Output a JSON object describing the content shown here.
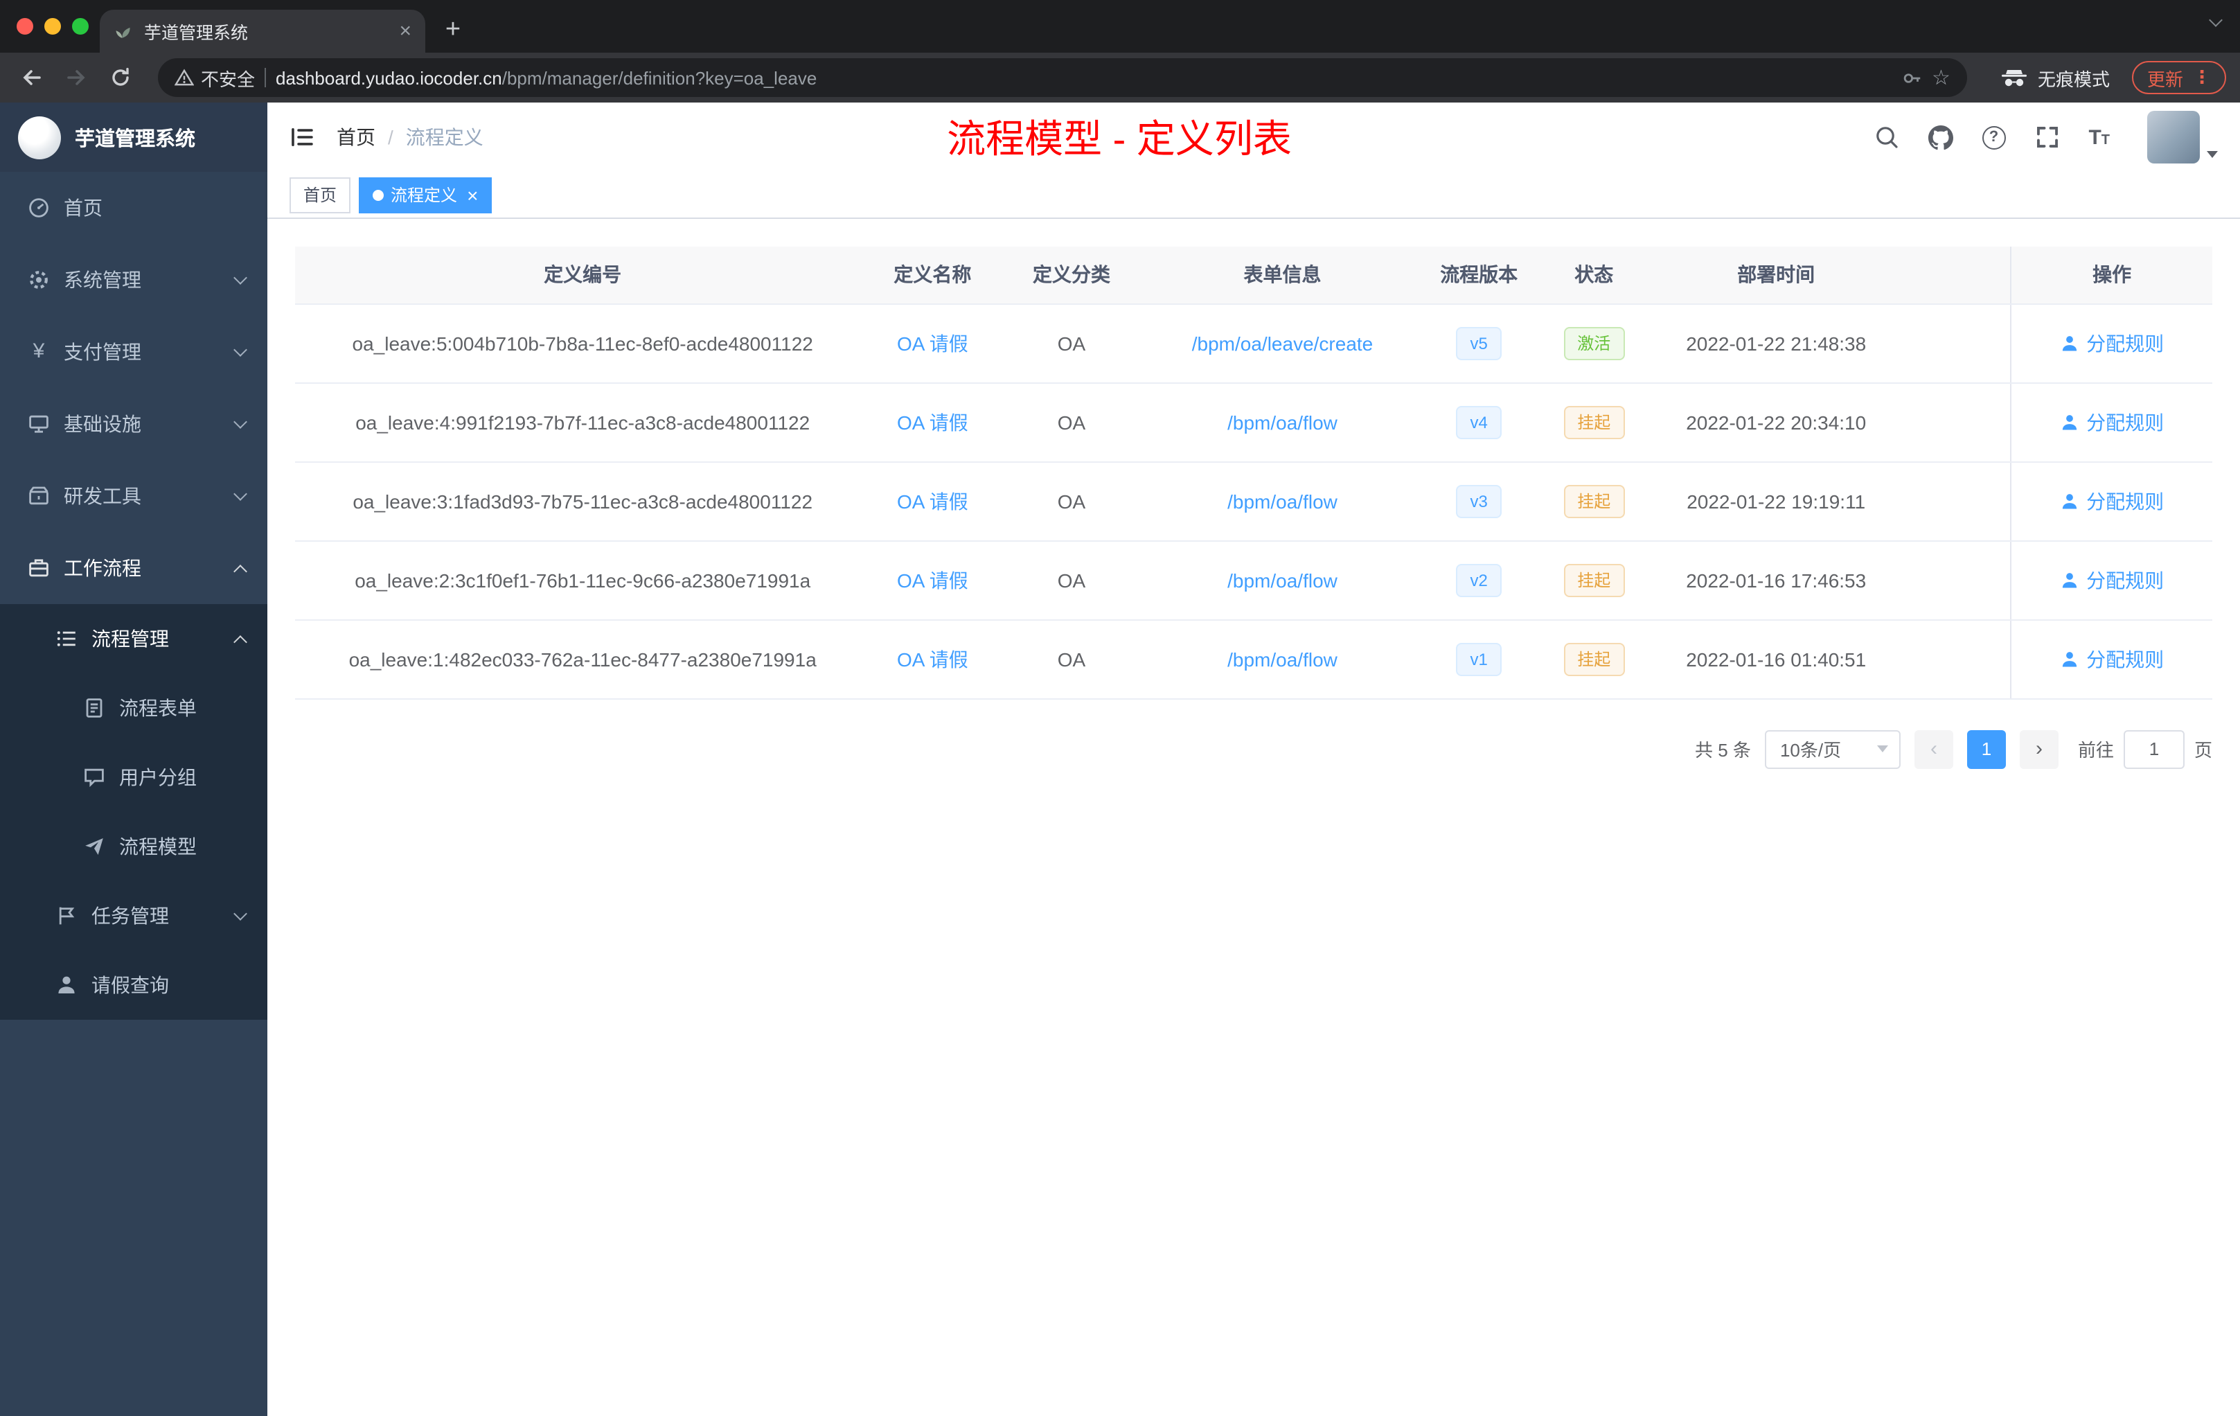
{
  "browser": {
    "tab_title": "芋道管理系统",
    "security_label": "不安全",
    "url_domain": "dashboard.yudao.iocoder.cn",
    "url_path": "/bpm/manager/definition?key=oa_leave",
    "incognito_label": "无痕模式",
    "update_label": "更新"
  },
  "sidebar": {
    "app_title": "芋道管理系统",
    "items": [
      {
        "label": "首页"
      },
      {
        "label": "系统管理"
      },
      {
        "label": "支付管理"
      },
      {
        "label": "基础设施"
      },
      {
        "label": "研发工具"
      },
      {
        "label": "工作流程"
      },
      {
        "label": "流程管理"
      },
      {
        "label": "流程表单"
      },
      {
        "label": "用户分组"
      },
      {
        "label": "流程模型"
      },
      {
        "label": "任务管理"
      },
      {
        "label": "请假查询"
      }
    ]
  },
  "header": {
    "breadcrumb": [
      "首页",
      "流程定义"
    ],
    "banner": "流程模型 - 定义列表"
  },
  "tags": [
    {
      "label": "首页"
    },
    {
      "label": "流程定义"
    }
  ],
  "table": {
    "columns": [
      "定义编号",
      "定义名称",
      "定义分类",
      "表单信息",
      "流程版本",
      "状态",
      "部署时间",
      "操作"
    ],
    "rows": [
      {
        "id": "oa_leave:5:004b710b-7b8a-11ec-8ef0-acde48001122",
        "name": "OA 请假",
        "category": "OA",
        "form": "/bpm/oa/leave/create",
        "version": "v5",
        "status": "激活",
        "status_type": "success",
        "deploy_time": "2022-01-22 21:48:38",
        "action": "分配规则"
      },
      {
        "id": "oa_leave:4:991f2193-7b7f-11ec-a3c8-acde48001122",
        "name": "OA 请假",
        "category": "OA",
        "form": "/bpm/oa/flow",
        "version": "v4",
        "status": "挂起",
        "status_type": "warning",
        "deploy_time": "2022-01-22 20:34:10",
        "action": "分配规则"
      },
      {
        "id": "oa_leave:3:1fad3d93-7b75-11ec-a3c8-acde48001122",
        "name": "OA 请假",
        "category": "OA",
        "form": "/bpm/oa/flow",
        "version": "v3",
        "status": "挂起",
        "status_type": "warning",
        "deploy_time": "2022-01-22 19:19:11",
        "action": "分配规则"
      },
      {
        "id": "oa_leave:2:3c1f0ef1-76b1-11ec-9c66-a2380e71991a",
        "name": "OA 请假",
        "category": "OA",
        "form": "/bpm/oa/flow",
        "version": "v2",
        "status": "挂起",
        "status_type": "warning",
        "deploy_time": "2022-01-16 17:46:53",
        "action": "分配规则"
      },
      {
        "id": "oa_leave:1:482ec033-762a-11ec-8477-a2380e71991a",
        "name": "OA 请假",
        "category": "OA",
        "form": "/bpm/oa/flow",
        "version": "v1",
        "status": "挂起",
        "status_type": "warning",
        "deploy_time": "2022-01-16 01:40:51",
        "action": "分配规则"
      }
    ]
  },
  "pagination": {
    "total_label": "共 5 条",
    "page_size": "10条/页",
    "current": "1",
    "goto_label": "前往",
    "goto_value": "1",
    "unit_label": "页"
  },
  "colors": {
    "accent": "#409eff",
    "banner": "#ff0000",
    "success": "#67c23a",
    "warning": "#e6a23c",
    "sidebar-bg": "#304156",
    "sidebar-sub-bg": "#1f2d3d"
  }
}
